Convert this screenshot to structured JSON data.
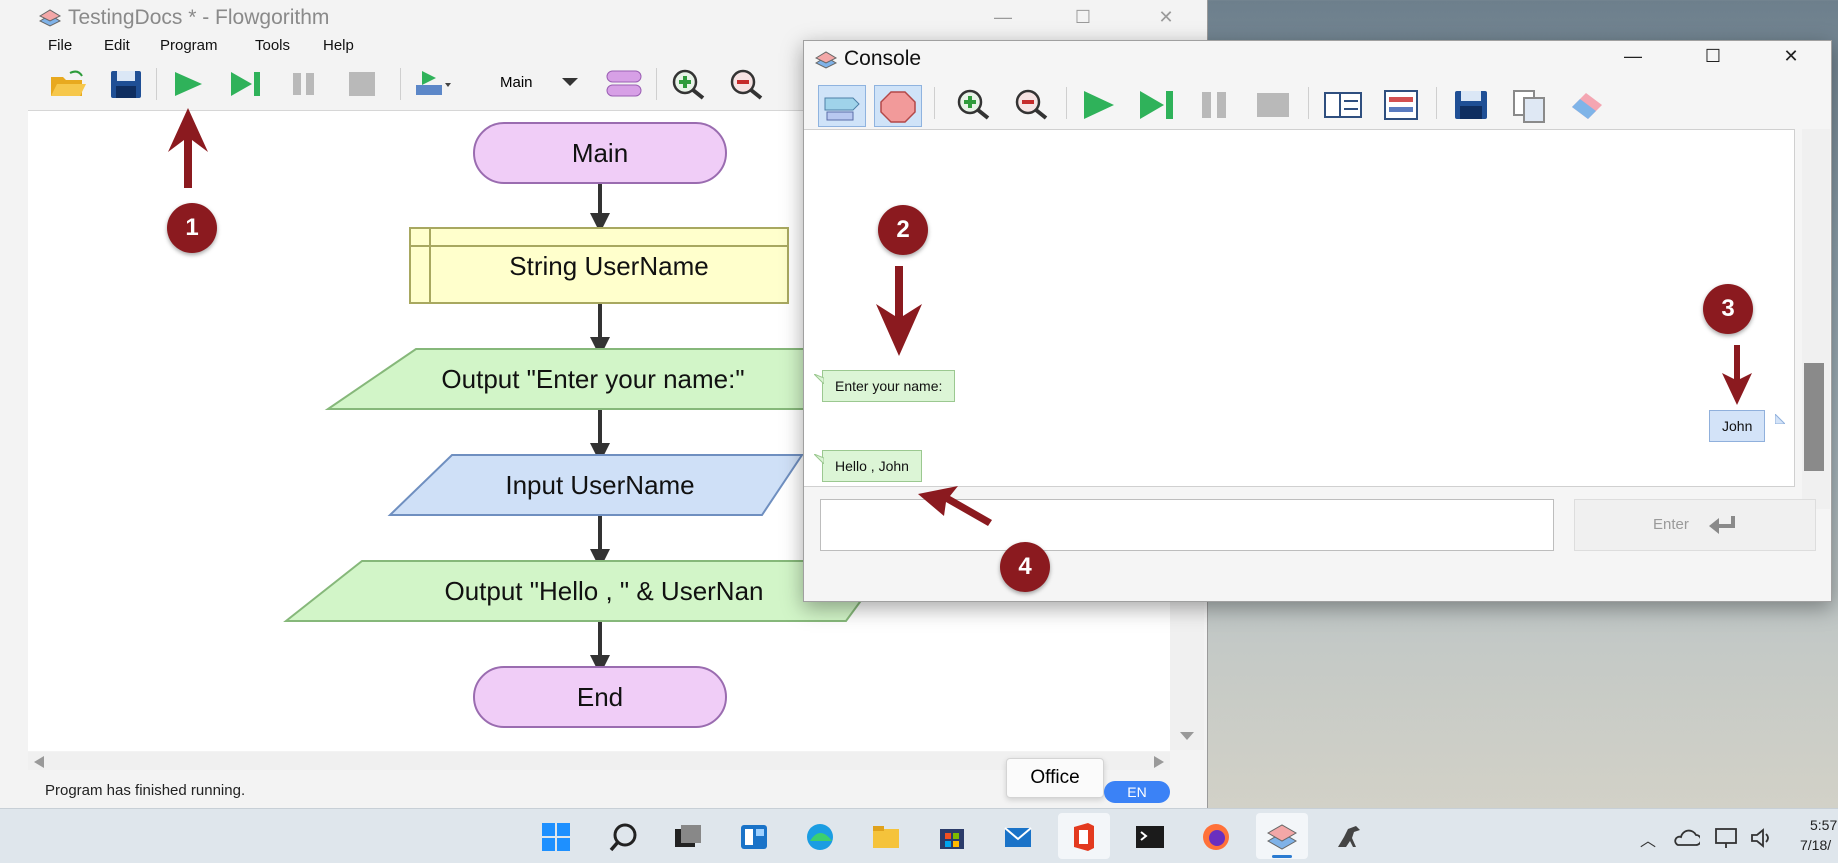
{
  "main_window": {
    "title": "TestingDocs * - Flowgorithm",
    "menu": [
      "File",
      "Edit",
      "Program",
      "Tools",
      "Help"
    ],
    "toolbar": {
      "open": "folder-open-icon",
      "save": "save-icon",
      "run": "play-icon",
      "step": "step-icon",
      "pause": "pause-icon",
      "stop": "stop-icon",
      "add_function": "add-function-icon",
      "function_select": "Main",
      "zoom_in": "zoom-in-icon",
      "zoom_out": "zoom-out-icon"
    },
    "flowchart": {
      "start": "Main",
      "declare": "String UserName",
      "output1": "Output \"Enter your name:\"",
      "input": "Input UserName",
      "output2": "Output \"Hello , \" & UserNan",
      "end": "End"
    },
    "status": "Program has finished running."
  },
  "console_window": {
    "title": "Console",
    "output_message": "Enter your name:",
    "user_input": "John",
    "result_message": "Hello , John",
    "enter_button": "Enter"
  },
  "annotations": [
    "1",
    "2",
    "3",
    "4"
  ],
  "office_popup": "Office",
  "language_badge": "EN",
  "clock": {
    "time": "5:57",
    "date": "7/18/"
  },
  "colors": {
    "start_end_fill": "#f0cdf7",
    "declare_fill": "#ffffcc",
    "output_fill": "#d2f5c8",
    "input_fill": "#cfe0f7",
    "badge": "#8b1a1f"
  }
}
